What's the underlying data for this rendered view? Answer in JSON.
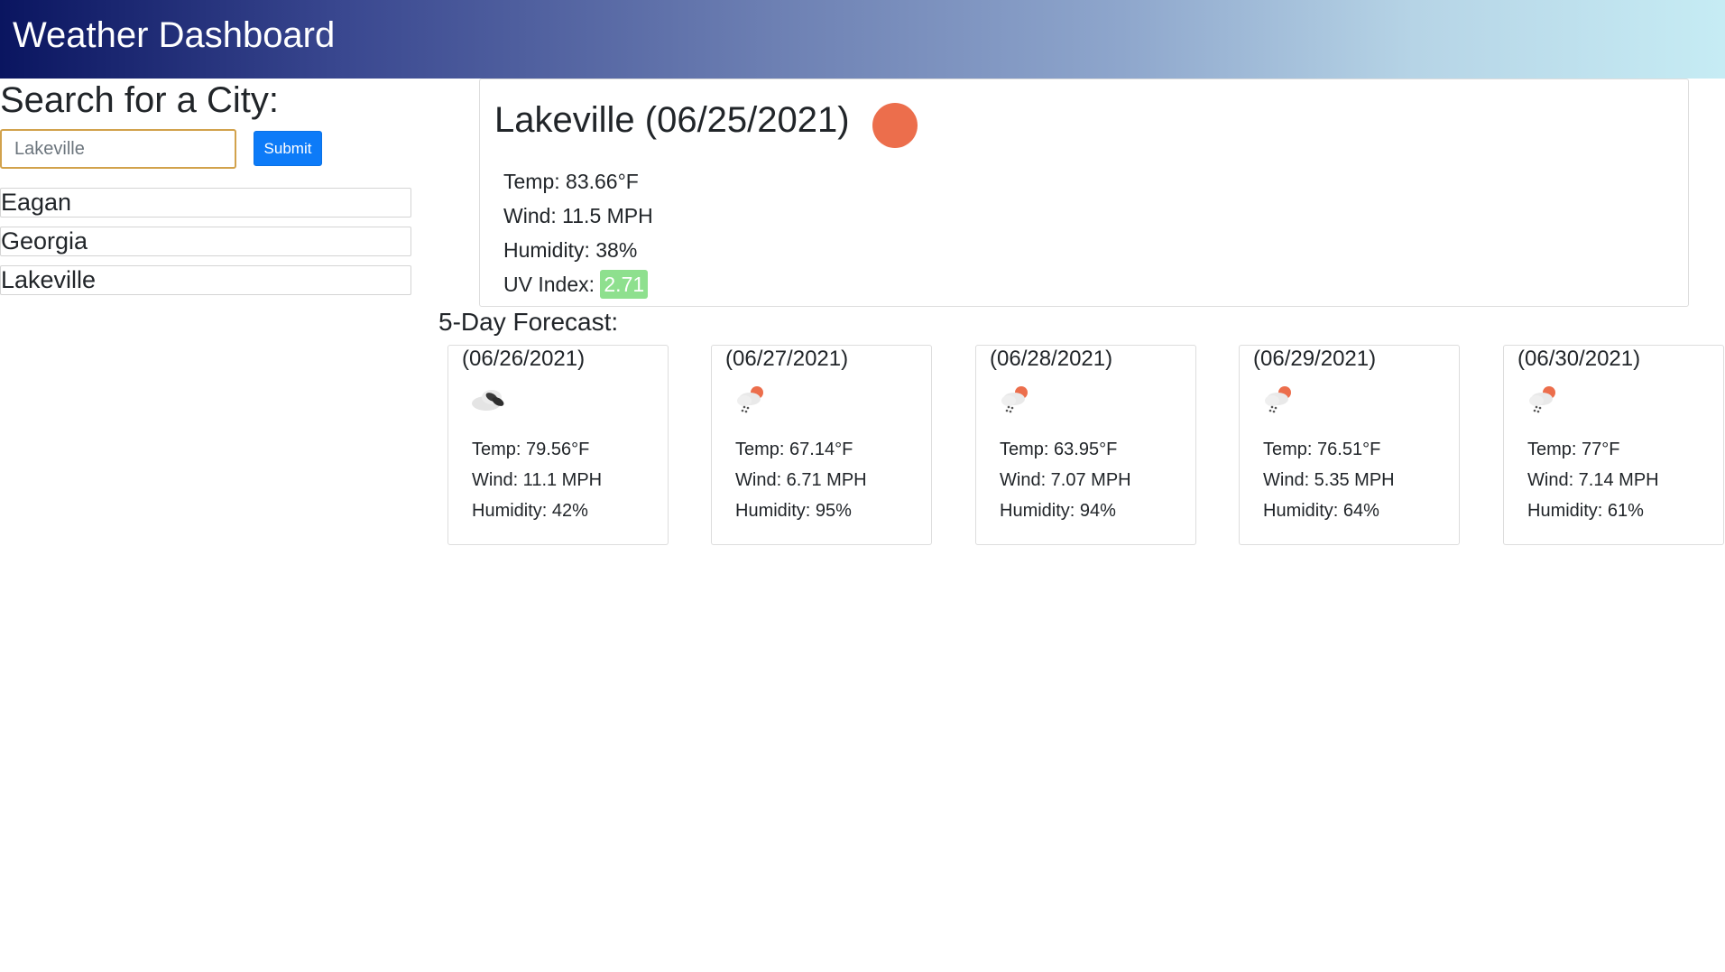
{
  "header": {
    "title": "Weather Dashboard"
  },
  "search": {
    "title": "Search for a City:",
    "placeholder": "Lakeville",
    "submit_label": "Submit"
  },
  "history": [
    {
      "label": "Eagan"
    },
    {
      "label": "Georgia"
    },
    {
      "label": "Lakeville"
    }
  ],
  "current": {
    "title": "Lakeville (06/25/2021)",
    "icon": "sun-icon",
    "temp": "Temp: 83.66°F",
    "wind": "Wind: 11.5 MPH",
    "humidity": "Humidity: 38%",
    "uv_label": "UV Index: ",
    "uv_value": "2.71",
    "uv_color": "#8ee08e"
  },
  "forecast": {
    "title": "5-Day Forecast:",
    "days": [
      {
        "date": "(06/26/2021)",
        "icon": "broken-clouds-icon",
        "temp": "Temp: 79.56°F",
        "wind": "Wind: 11.1 MPH",
        "humidity": "Humidity: 42%"
      },
      {
        "date": "(06/27/2021)",
        "icon": "rain-icon",
        "temp": "Temp: 67.14°F",
        "wind": "Wind: 6.71 MPH",
        "humidity": "Humidity: 95%"
      },
      {
        "date": "(06/28/2021)",
        "icon": "rain-icon",
        "temp": "Temp: 63.95°F",
        "wind": "Wind: 7.07 MPH",
        "humidity": "Humidity: 94%"
      },
      {
        "date": "(06/29/2021)",
        "icon": "rain-icon",
        "temp": "Temp: 76.51°F",
        "wind": "Wind: 5.35 MPH",
        "humidity": "Humidity: 64%"
      },
      {
        "date": "(06/30/2021)",
        "icon": "rain-icon",
        "temp": "Temp: 77°F",
        "wind": "Wind: 7.14 MPH",
        "humidity": "Humidity: 61%"
      }
    ]
  },
  "colors": {
    "accent": "#0d7bf8",
    "sun": "#ec6e4c"
  }
}
